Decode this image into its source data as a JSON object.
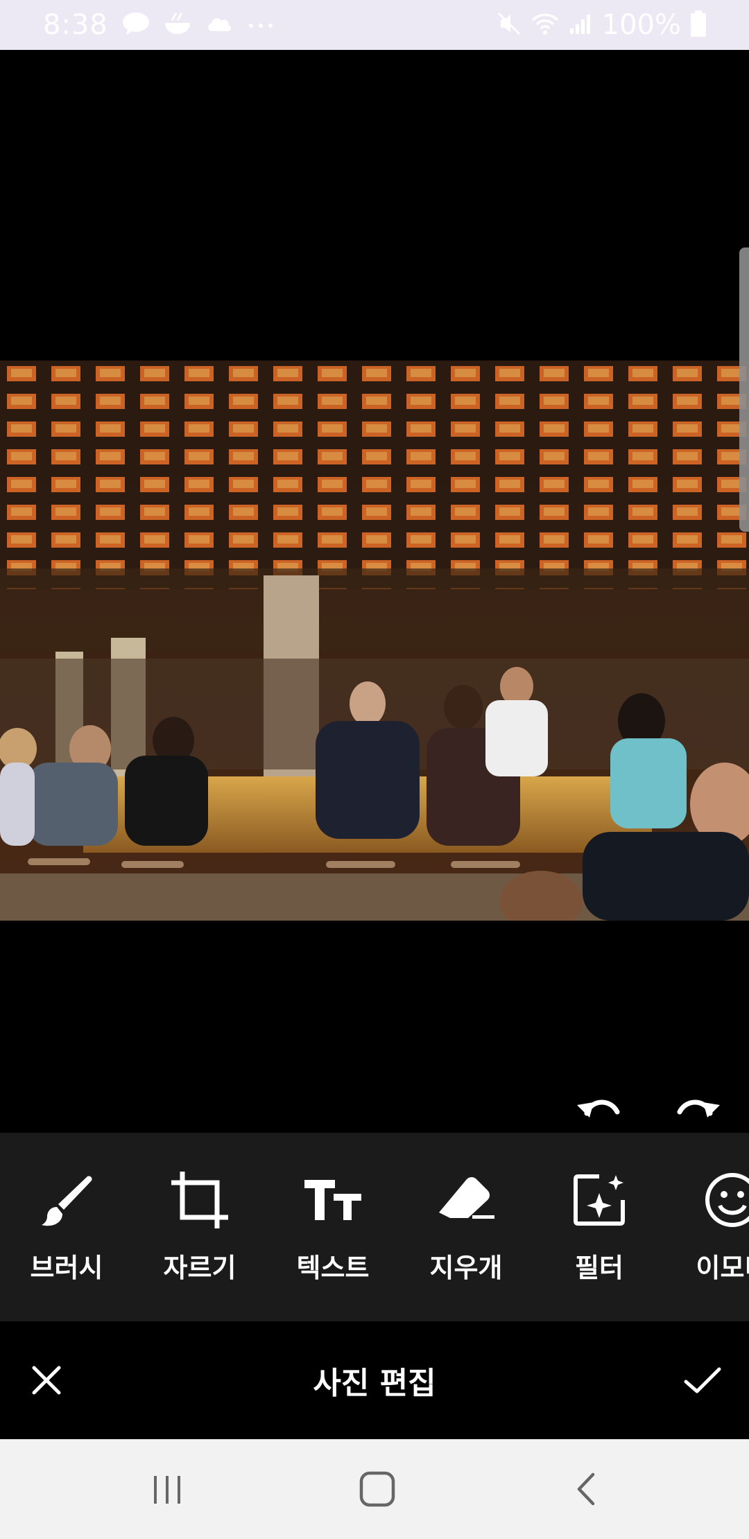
{
  "status_bar": {
    "time": "8:38",
    "battery": "100%",
    "left_icons": [
      "talk-icon",
      "bowl-icon",
      "cloud-icon",
      "more-dots-icon"
    ],
    "right_icons": [
      "mute-icon",
      "wifi-icon",
      "signal-icon",
      "battery-icon"
    ]
  },
  "editor": {
    "title": "사진 편집",
    "undo": "undo-icon",
    "redo": "redo-icon"
  },
  "tools": [
    {
      "label": "브러시",
      "icon": "brush-icon"
    },
    {
      "label": "자르기",
      "icon": "crop-icon"
    },
    {
      "label": "텍스트",
      "icon": "text-icon"
    },
    {
      "label": "지우개",
      "icon": "eraser-icon"
    },
    {
      "label": "필터",
      "icon": "filter-icon"
    },
    {
      "label": "이모티",
      "icon": "emoji-icon"
    }
  ],
  "colors": {
    "status_bar_bg": "#ece8f4",
    "tools_bg": "#1b1b1b",
    "nav_bg": "#f2f2f2",
    "icon": "#ffffff"
  }
}
